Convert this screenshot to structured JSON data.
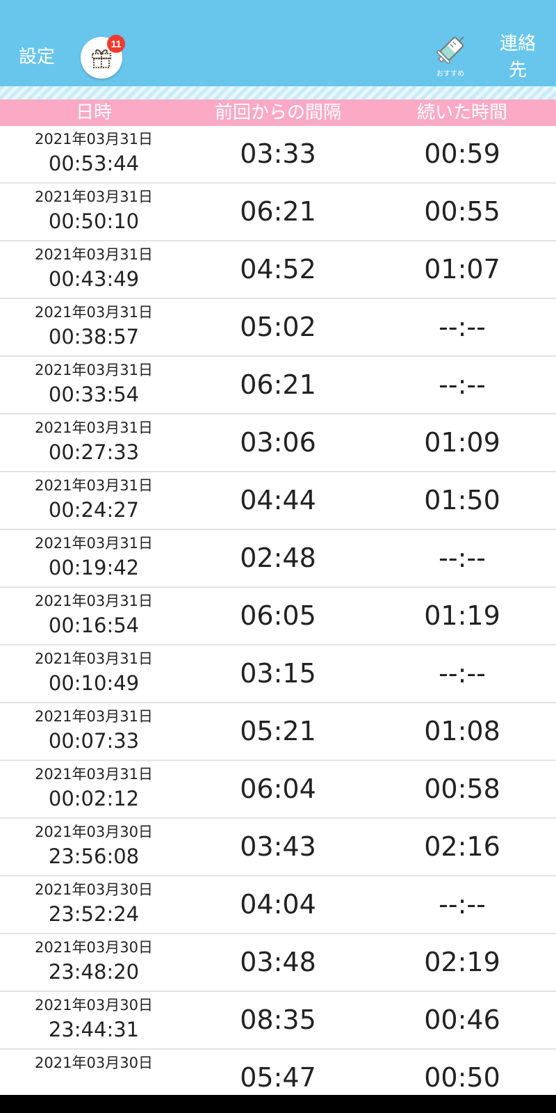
{
  "header": {
    "settings_label": "設定",
    "gift_badge_count": "11",
    "recommend_label": "おすすめ",
    "contacts_label_line1": "連絡",
    "contacts_label_line2": "先",
    "bar_color": "#68c5ec"
  },
  "table": {
    "header_color": "#fba9c4",
    "columns": [
      "日時",
      "前回からの間隔",
      "続いた時間"
    ],
    "rows": [
      {
        "date": "2021年03月31日",
        "time": "00:53:44",
        "interval": "03:33",
        "duration": "00:59"
      },
      {
        "date": "2021年03月31日",
        "time": "00:50:10",
        "interval": "06:21",
        "duration": "00:55"
      },
      {
        "date": "2021年03月31日",
        "time": "00:43:49",
        "interval": "04:52",
        "duration": "01:07"
      },
      {
        "date": "2021年03月31日",
        "time": "00:38:57",
        "interval": "05:02",
        "duration": "--:--"
      },
      {
        "date": "2021年03月31日",
        "time": "00:33:54",
        "interval": "06:21",
        "duration": "--:--"
      },
      {
        "date": "2021年03月31日",
        "time": "00:27:33",
        "interval": "03:06",
        "duration": "01:09"
      },
      {
        "date": "2021年03月31日",
        "time": "00:24:27",
        "interval": "04:44",
        "duration": "01:50"
      },
      {
        "date": "2021年03月31日",
        "time": "00:19:42",
        "interval": "02:48",
        "duration": "--:--"
      },
      {
        "date": "2021年03月31日",
        "time": "00:16:54",
        "interval": "06:05",
        "duration": "01:19"
      },
      {
        "date": "2021年03月31日",
        "time": "00:10:49",
        "interval": "03:15",
        "duration": "--:--"
      },
      {
        "date": "2021年03月31日",
        "time": "00:07:33",
        "interval": "05:21",
        "duration": "01:08"
      },
      {
        "date": "2021年03月31日",
        "time": "00:02:12",
        "interval": "06:04",
        "duration": "00:58"
      },
      {
        "date": "2021年03月30日",
        "time": "23:56:08",
        "interval": "03:43",
        "duration": "02:16"
      },
      {
        "date": "2021年03月30日",
        "time": "23:52:24",
        "interval": "04:04",
        "duration": "--:--"
      },
      {
        "date": "2021年03月30日",
        "time": "23:48:20",
        "interval": "03:48",
        "duration": "02:19"
      },
      {
        "date": "2021年03月30日",
        "time": "23:44:31",
        "interval": "08:35",
        "duration": "00:46"
      },
      {
        "date": "2021年03月30日",
        "time": "",
        "interval": "05:47",
        "duration": "00:50"
      }
    ]
  },
  "icons": {
    "gift": "gift-icon",
    "recommend": "syringe-icon"
  }
}
